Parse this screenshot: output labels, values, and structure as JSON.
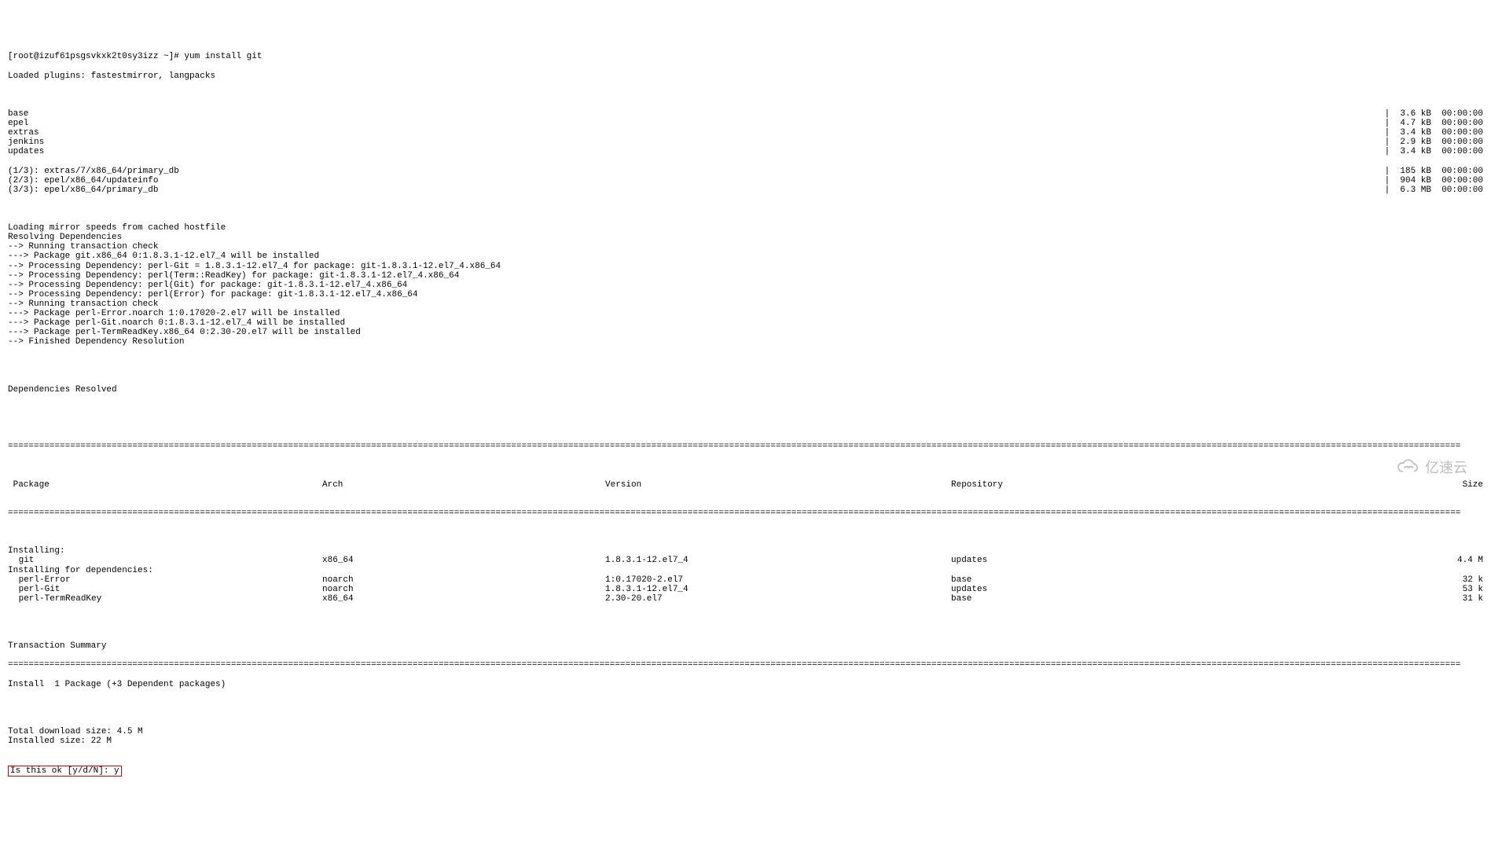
{
  "prompt": "[root@izuf61psgsvkxk2t0sy3izz ~]# yum install git",
  "header": "Loaded plugins: fastestmirror, langpacks",
  "repos": [
    {
      "name": "base",
      "size": "3.6 kB",
      "time": "00:00:00"
    },
    {
      "name": "epel",
      "size": "4.7 kB",
      "time": "00:00:00"
    },
    {
      "name": "extras",
      "size": "3.4 kB",
      "time": "00:00:00"
    },
    {
      "name": "jenkins",
      "size": "2.9 kB",
      "time": "00:00:00"
    },
    {
      "name": "updates",
      "size": "3.4 kB",
      "time": "00:00:00"
    }
  ],
  "downloads": [
    {
      "name": "(1/3): extras/7/x86_64/primary_db",
      "size": "185 kB",
      "time": "00:00:00"
    },
    {
      "name": "(2/3): epel/x86_64/updateinfo",
      "size": "904 kB",
      "time": "00:00:00"
    },
    {
      "name": "(3/3): epel/x86_64/primary_db",
      "size": "6.3 MB",
      "time": "00:00:00"
    }
  ],
  "pre": [
    "Loading mirror speeds from cached hostfile",
    "Resolving Dependencies",
    "--> Running transaction check",
    "---> Package git.x86_64 0:1.8.3.1-12.el7_4 will be installed",
    "--> Processing Dependency: perl-Git = 1.8.3.1-12.el7_4 for package: git-1.8.3.1-12.el7_4.x86_64",
    "--> Processing Dependency: perl(Term::ReadKey) for package: git-1.8.3.1-12.el7_4.x86_64",
    "--> Processing Dependency: perl(Git) for package: git-1.8.3.1-12.el7_4.x86_64",
    "--> Processing Dependency: perl(Error) for package: git-1.8.3.1-12.el7_4.x86_64",
    "--> Running transaction check",
    "---> Package perl-Error.noarch 1:0.17020-2.el7 will be installed",
    "---> Package perl-Git.noarch 0:1.8.3.1-12.el7_4 will be installed",
    "---> Package perl-TermReadKey.x86_64 0:2.30-20.el7 will be installed",
    "--> Finished Dependency Resolution"
  ],
  "deps_resolved": "Dependencies Resolved",
  "table": {
    "headers": {
      "pkg": " Package",
      "arch": "Arch",
      "ver": "Version",
      "repo": "Repository",
      "size": "Size"
    },
    "sections": [
      {
        "title": "Installing:",
        "rows": [
          {
            "pkg": "git",
            "arch": "x86_64",
            "ver": "1.8.3.1-12.el7_4",
            "repo": "updates",
            "size": "4.4 M"
          }
        ]
      },
      {
        "title": "Installing for dependencies:",
        "rows": [
          {
            "pkg": "perl-Error",
            "arch": "noarch",
            "ver": "1:0.17020-2.el7",
            "repo": "base",
            "size": "32 k"
          },
          {
            "pkg": "perl-Git",
            "arch": "noarch",
            "ver": "1.8.3.1-12.el7_4",
            "repo": "updates",
            "size": "53 k"
          },
          {
            "pkg": "perl-TermReadKey",
            "arch": "x86_64",
            "ver": "2.30-20.el7",
            "repo": "base",
            "size": "31 k"
          }
        ]
      }
    ]
  },
  "txn_summary": "Transaction Summary",
  "install_line": "Install  1 Package (+3 Dependent packages)",
  "totals": [
    "Total download size: 4.5 M",
    "Installed size: 22 M"
  ],
  "confirm": "Is this ok [y/d/N]: y",
  "watermark": "亿速云"
}
